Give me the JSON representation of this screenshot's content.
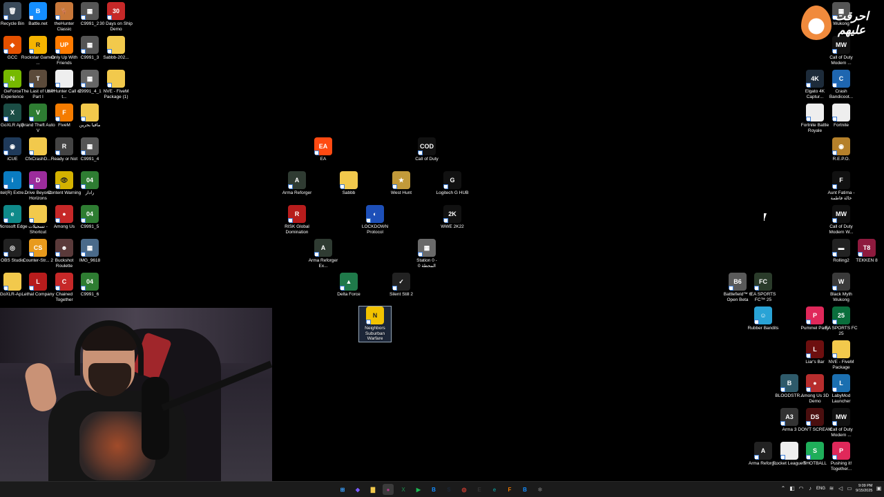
{
  "desktop": {
    "icons": [
      {
        "label": "Recycle Bin",
        "glyph": "🗑",
        "color": "#3a4a5a"
      },
      {
        "label": "Battle.net",
        "glyph": "B",
        "color": "#148eff"
      },
      {
        "label": "theHunter Classic",
        "glyph": "🦌",
        "color": "#c8783a"
      },
      {
        "label": "C9991_2",
        "glyph": "▦",
        "color": "#555"
      },
      {
        "label": "30 Days on Ship Demo",
        "glyph": "30",
        "color": "#c62828"
      },
      {
        "label": "GCC",
        "glyph": "◆",
        "color": "#e65100"
      },
      {
        "label": "Rockstar Games ...",
        "glyph": "R",
        "color": "#f5b400"
      },
      {
        "label": "Only Up With Friends",
        "glyph": "UP",
        "color": "#ff7b00"
      },
      {
        "label": "C9991_3",
        "glyph": "▦",
        "color": "#555"
      },
      {
        "label": "Sabbb-202...",
        "glyph": "",
        "color": "#f2c94c"
      },
      {
        "label": "GeForce Experience",
        "glyph": "N",
        "color": "#76b900"
      },
      {
        "label": "The Last of Us™ Part I",
        "glyph": "T",
        "color": "#5b4a3a"
      },
      {
        "label": "theHunter Call of t...",
        "glyph": "",
        "color": "#eeeeee"
      },
      {
        "label": "C9991_4_1",
        "glyph": "▦",
        "color": "#666"
      },
      {
        "label": "NVE - FiveM Package (1)",
        "glyph": "",
        "color": "#f2c94c"
      },
      {
        "label": "GoXLR App",
        "glyph": "X",
        "color": "#1b4d45"
      },
      {
        "label": "Grand Theft Auto V",
        "glyph": "V",
        "color": "#2e7d32"
      },
      {
        "label": "FiveM",
        "glyph": "F",
        "color": "#f57c00"
      },
      {
        "label": "مافيا بحرين",
        "glyph": "",
        "color": "#f2c94c"
      },
      {
        "label": "iCUE",
        "glyph": "◉",
        "color": "#1f3a5a"
      },
      {
        "label": "CfxCrashD...",
        "glyph": "",
        "color": "#f2c94c"
      },
      {
        "label": "Ready or Not",
        "glyph": "R",
        "color": "#444"
      },
      {
        "label": "C9991_4",
        "glyph": "▦",
        "color": "#555"
      },
      {
        "label": "Intel(R) Extre...",
        "glyph": "i",
        "color": "#0a7cc1"
      },
      {
        "label": "Drive Beyond Horizons",
        "glyph": "D",
        "color": "#9c2c9c"
      },
      {
        "label": "Content Warning",
        "glyph": "👁",
        "color": "#d4b200"
      },
      {
        "label": "رادار",
        "glyph": "04",
        "color": "#2e7d32"
      },
      {
        "label": "Microsoft Edge",
        "glyph": "e",
        "color": "#0f8a8a"
      },
      {
        "label": "تسجيلات - Shortcut",
        "glyph": "",
        "color": "#f2c94c"
      },
      {
        "label": "Among Us",
        "glyph": "●",
        "color": "#c62828"
      },
      {
        "label": "C9991_5",
        "glyph": "04",
        "color": "#2e7d32"
      },
      {
        "label": "OBS Studio",
        "glyph": "◎",
        "color": "#222"
      },
      {
        "label": "Counter-Str... 2",
        "glyph": "CS",
        "color": "#e89a1c"
      },
      {
        "label": "Buckshot Roulette",
        "glyph": "☻",
        "color": "#5a3a3a"
      },
      {
        "label": "IMG_9618",
        "glyph": "▦",
        "color": "#4a6a8a"
      },
      {
        "label": "GoXLR-Ap...",
        "glyph": "",
        "color": "#f2c94c"
      },
      {
        "label": "Lethal Company",
        "glyph": "L",
        "color": "#b71c1c"
      },
      {
        "label": "Chained Together",
        "glyph": "C",
        "color": "#c62828"
      },
      {
        "label": "C9991_6",
        "glyph": "04",
        "color": "#2e7d32"
      },
      {
        "label": "EA",
        "glyph": "EA",
        "color": "#ff4a12"
      },
      {
        "label": "Call of Duty",
        "glyph": "COD",
        "color": "#111"
      },
      {
        "label": "Arma Reforger",
        "glyph": "A",
        "color": "#2f3b32"
      },
      {
        "label": "Sabbb",
        "glyph": "",
        "color": "#f2c94c"
      },
      {
        "label": "West Hunt",
        "glyph": "★",
        "color": "#c29a3a"
      },
      {
        "label": "Logitech G HUB",
        "glyph": "G",
        "color": "#111"
      },
      {
        "label": "RISK Global Domination",
        "glyph": "R",
        "color": "#b71c1c"
      },
      {
        "label": "LOCKDOWN Protocol",
        "glyph": "◐",
        "color": "#1d4fb8"
      },
      {
        "label": "WWE 2K22",
        "glyph": "2K",
        "color": "#111"
      },
      {
        "label": "Arma Reforger Ex...",
        "glyph": "A",
        "color": "#2f3b32"
      },
      {
        "label": "Station 0 - المحطة 0",
        "glyph": "▦",
        "color": "#6a6a6a"
      },
      {
        "label": "Delta Force",
        "glyph": "▲",
        "color": "#1f7a4a"
      },
      {
        "label": "Silent Still 2",
        "glyph": "✓",
        "color": "#222"
      },
      {
        "label": "Neighbors Suburban Warfare",
        "glyph": "N",
        "color": "#f2c200"
      },
      {
        "label": "Wukong",
        "glyph": "▦",
        "color": "#555"
      },
      {
        "label": "Call of Duty Modern ...",
        "glyph": "MW",
        "color": "#111"
      },
      {
        "label": "Elgato 4K Captur...",
        "glyph": "4K",
        "color": "#1d2b3a"
      },
      {
        "label": "Crash Bandicoot...",
        "glyph": "C",
        "color": "#1e66b0"
      },
      {
        "label": "Fortnite Battle Royale",
        "glyph": "",
        "color": "#eeeeee"
      },
      {
        "label": "Fortnite",
        "glyph": "",
        "color": "#eeeeee"
      },
      {
        "label": "R.E.P.O.",
        "glyph": "◉",
        "color": "#b5802a"
      },
      {
        "label": "Aunt Fatima - خالة فاطمة",
        "glyph": "F",
        "color": "#111"
      },
      {
        "label": "Call of Duty Modern W...",
        "glyph": "MW",
        "color": "#111"
      },
      {
        "label": "Rolling2",
        "glyph": "▬",
        "color": "#222"
      },
      {
        "label": "TEKKEN 8",
        "glyph": "T8",
        "color": "#8e1a3e"
      },
      {
        "label": "Battlefield™ 6 Open Beta",
        "glyph": "B6",
        "color": "#5a5a5a"
      },
      {
        "label": "EA SPORTS FC™ 25",
        "glyph": "FC",
        "color": "#2a3b2a"
      },
      {
        "label": "Black Myth Wukong",
        "glyph": "W",
        "color": "#3a3a3a"
      },
      {
        "label": "Rubber Bandits",
        "glyph": "☺",
        "color": "#29a3d6"
      },
      {
        "label": "Pummel Party",
        "glyph": "P",
        "color": "#e0285a"
      },
      {
        "label": "EA SPORTS FC 25",
        "glyph": "25",
        "color": "#0a6e3c"
      },
      {
        "label": "Liar's Bar",
        "glyph": "L",
        "color": "#6d0f0f"
      },
      {
        "label": "NVE - FiveM Package",
        "glyph": "",
        "color": "#f2c94c"
      },
      {
        "label": "BLOODSTR...",
        "glyph": "B",
        "color": "#2e5a6a"
      },
      {
        "label": "Among Us 3D Demo",
        "glyph": "●",
        "color": "#b72d2d"
      },
      {
        "label": "LabyMod Launcher",
        "glyph": "L",
        "color": "#1b6fb0"
      },
      {
        "label": "Arma 3",
        "glyph": "A3",
        "color": "#333"
      },
      {
        "label": "DON'T SCREAM",
        "glyph": "DS",
        "color": "#4a0f0f"
      },
      {
        "label": "Call of Duty Modern ...",
        "glyph": "MW",
        "color": "#111"
      },
      {
        "label": "Arma Reforg...",
        "glyph": "A",
        "color": "#222"
      },
      {
        "label": "Rocket League®",
        "glyph": "",
        "color": "#eeeeee"
      },
      {
        "label": "SHOTBALL",
        "glyph": "S",
        "color": "#1fae5a"
      },
      {
        "label": "Pushing it! Together...",
        "glyph": "P",
        "color": "#e0285a"
      }
    ]
  },
  "logo": {
    "text": "احرقت عليهم"
  },
  "taskbar": {
    "apps": [
      {
        "name": "windows-start-icon",
        "glyph": "⊞",
        "color": "#3aa0ff"
      },
      {
        "name": "copilot-icon",
        "glyph": "◆",
        "color": "#7b5cff"
      },
      {
        "name": "file-explorer-icon",
        "glyph": "▇",
        "color": "#f2c94c"
      },
      {
        "name": "obs-taskbar-icon",
        "glyph": "●",
        "color": "#b03a8a"
      },
      {
        "name": "excel-icon",
        "glyph": "X",
        "color": "#1d6f42"
      },
      {
        "name": "spotify-icon",
        "glyph": "▶",
        "color": "#1db954"
      },
      {
        "name": "battlenet-icon",
        "glyph": "B",
        "color": "#148eff"
      },
      {
        "name": "steam-icon",
        "glyph": "S",
        "color": "#1b2838"
      },
      {
        "name": "chrome-icon",
        "glyph": "◎",
        "color": "#e94235"
      },
      {
        "name": "elgato-icon",
        "glyph": "E",
        "color": "#333"
      },
      {
        "name": "edge-icon",
        "glyph": "e",
        "color": "#0f8a8a"
      },
      {
        "name": "fivem-icon",
        "glyph": "F",
        "color": "#f57c00"
      },
      {
        "name": "battlenet2-icon",
        "glyph": "B",
        "color": "#148eff"
      },
      {
        "name": "settings-icon",
        "glyph": "✱",
        "color": "#555"
      }
    ],
    "tray": {
      "language": "ENG",
      "time": "9:09 PM",
      "date": "9/15/2025"
    }
  }
}
